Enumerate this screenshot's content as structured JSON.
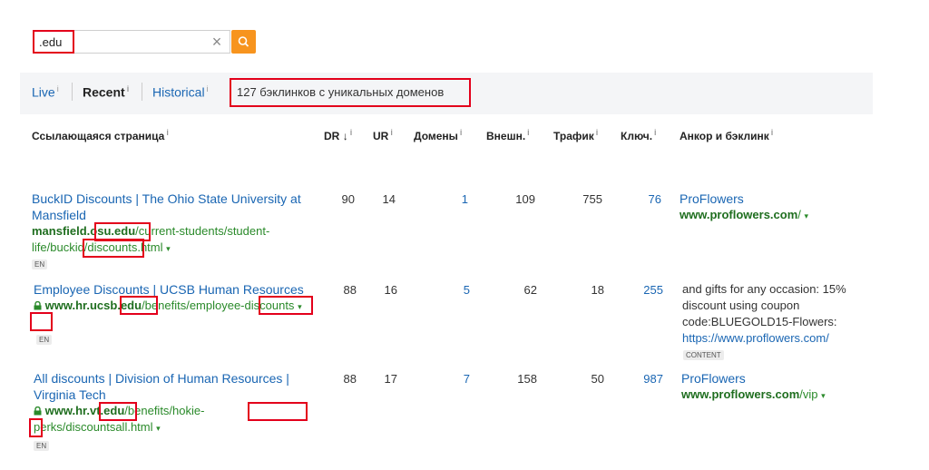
{
  "search": {
    "value": ".edu"
  },
  "tabs": {
    "live": "Live",
    "recent": "Recent",
    "historical": "Historical",
    "info": "i"
  },
  "summary": "127 бэклинков с уникальных доменов",
  "columns": {
    "page": "Ссылающаяся страница",
    "dr": "DR",
    "sort": "↓",
    "ur": "UR",
    "domains": "Домены",
    "external": "Внешн.",
    "traffic": "Трафик",
    "keywords": "Ключ.",
    "anchor": "Анкор и бэклинк",
    "info": "i"
  },
  "rows": [
    {
      "title": "BuckID Discounts | The Ohio State University at Mansfield",
      "url_host_a": "mansfield.osu",
      "url_host_b": ".edu",
      "url_path_a": "/current-students/student-life/buckid/",
      "url_path_b": "discounts",
      "url_path_c": ".html",
      "lang": "EN",
      "dr": "90",
      "ur": "14",
      "domains": "1",
      "external": "109",
      "traffic": "755",
      "keywords": "76",
      "anchor_title": "ProFlowers",
      "anchor_host": "www.proflowers.com",
      "anchor_path": "/"
    },
    {
      "title": "Employee Discounts | UCSB Human Resources",
      "url_host_a": "www.hr.ucsb",
      "url_host_b": ".edu",
      "url_path_a": "/benefits/employee-",
      "url_path_b": "discounts",
      "url_path_c": "",
      "lang": "EN",
      "dr": "88",
      "ur": "16",
      "domains": "5",
      "external": "62",
      "traffic": "18",
      "keywords": "255",
      "anchor_text": "and gifts for any occasion: 15% discount using coupon code:BLUEGOLD15-Flowers:",
      "anchor_link": "https://www.proflowers.com/",
      "content_badge": "CONTENT"
    },
    {
      "title": "All discounts | Division of Human Resources | Virginia Tech",
      "url_host_a": "www.hr.vt",
      "url_host_b": ".edu",
      "url_path_a": "/benefits/hokie-perks/",
      "url_path_b": "discounts",
      "url_path_c": "all.html",
      "lang": "EN",
      "dr": "88",
      "ur": "17",
      "domains": "7",
      "external": "158",
      "traffic": "50",
      "keywords": "987",
      "anchor_title": "ProFlowers",
      "anchor_host": "www.proflowers.com",
      "anchor_path": "/vip"
    }
  ],
  "icons": {
    "clear": "×",
    "caret": "▾",
    "lock": "lock-icon",
    "search": "search-icon"
  },
  "colors": {
    "highlight": "#e3001b",
    "link": "#1a66b3",
    "url": "#2a8a2a",
    "search_button": "#f7941e"
  }
}
